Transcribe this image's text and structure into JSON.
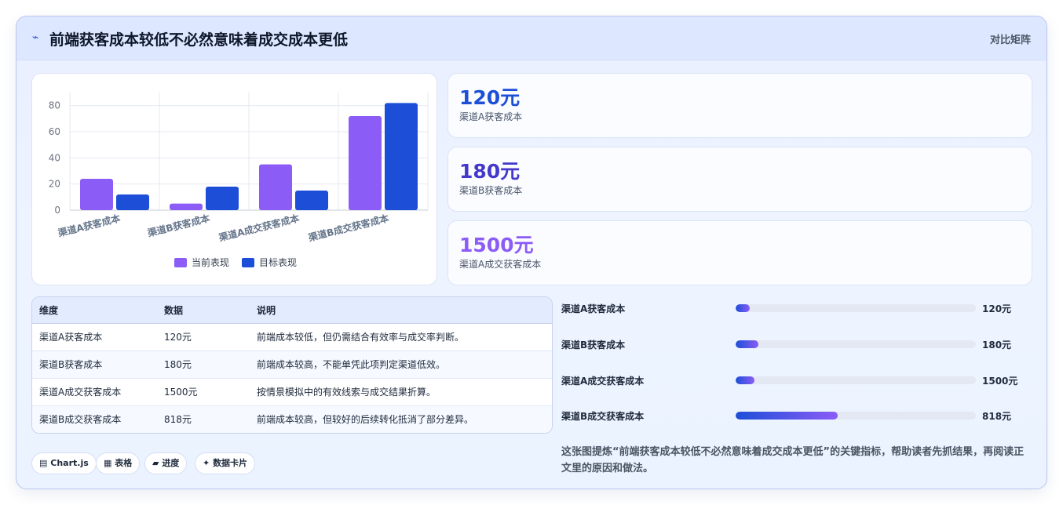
{
  "header": {
    "title": "前端获客成本较低不必然意味着成交成本更低",
    "tag": "对比矩阵",
    "icon": "lightning-icon"
  },
  "chart_data": {
    "type": "bar",
    "categories": [
      "渠道A获客成本",
      "渠道B获客成本",
      "渠道A成交获客成本",
      "渠道B成交获客成本"
    ],
    "series": [
      {
        "name": "当前表现",
        "values": [
          24,
          5,
          35,
          72
        ],
        "color": "#8b5cf6"
      },
      {
        "name": "目标表现",
        "values": [
          12,
          18,
          15,
          82
        ],
        "color": "#1d4ed8"
      }
    ],
    "yticks": [
      "0",
      "20",
      "40",
      "60",
      "80"
    ],
    "ylim": [
      0,
      90
    ],
    "grid": true,
    "legend": "bottom"
  },
  "metrics": [
    {
      "value": "120元",
      "label": "渠道A获客成本",
      "color": "#1d4ed8"
    },
    {
      "value": "180元",
      "label": "渠道B获客成本",
      "color": "#4338ca"
    },
    {
      "value": "1500元",
      "label": "渠道A成交获客成本",
      "color": "#8b5cf6"
    }
  ],
  "table": {
    "headers": [
      "维度",
      "数据",
      "说明"
    ],
    "rows": [
      [
        "渠道A获客成本",
        "120元",
        "前端成本较低，但仍需结合有效率与成交率判断。"
      ],
      [
        "渠道B获客成本",
        "180元",
        "前端成本较高，不能单凭此项判定渠道低效。"
      ],
      [
        "渠道A成交获客成本",
        "1500元",
        "按情景模拟中的有效线索与成交结果折算。"
      ],
      [
        "渠道B成交获客成本",
        "818元",
        "前端成本较高，但较好的后续转化抵消了部分差异。"
      ]
    ]
  },
  "progress": [
    {
      "label": "渠道A获客成本",
      "value": "120元",
      "fraction": 0.06
    },
    {
      "label": "渠道B获客成本",
      "value": "180元",
      "fraction": 0.095
    },
    {
      "label": "渠道A成交获客成本",
      "value": "1500元",
      "fraction": 0.08
    },
    {
      "label": "渠道B成交获客成本",
      "value": "818元",
      "fraction": 0.425
    }
  ],
  "chips": [
    {
      "icon": "chart-icon",
      "glyph": "▤",
      "label": "Chart.js"
    },
    {
      "icon": "table-icon",
      "glyph": "▦",
      "label": "表格"
    },
    {
      "icon": "progress-icon",
      "glyph": "▰",
      "label": "进度"
    },
    {
      "icon": "sparkle-icon",
      "glyph": "✦",
      "label": "数据卡片"
    }
  ],
  "summary": "这张图提炼“前端获客成本较低不必然意味着成交成本更低”的关键指标，帮助读者先抓结果，再阅读正文里的原因和做法。"
}
